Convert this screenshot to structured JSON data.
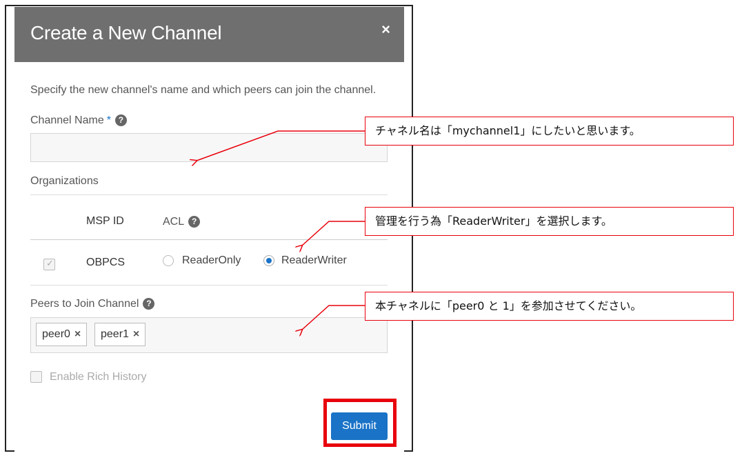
{
  "dialog": {
    "title": "Create a New Channel",
    "close_glyph": "×",
    "intro": "Specify the new channel's name and which peers can join the channel.",
    "channel_name": {
      "label": "Channel Name",
      "required_mark": "*",
      "value": ""
    },
    "help_glyph": "?",
    "organizations": {
      "label": "Organizations",
      "columns": [
        "MSP ID",
        "ACL"
      ],
      "rows": [
        {
          "checked": true,
          "msp_id": "OBPCS",
          "acl_options": [
            "ReaderOnly",
            "ReaderWriter"
          ],
          "acl_selected": "ReaderWriter"
        }
      ]
    },
    "peers": {
      "label": "Peers to Join Channel",
      "chips": [
        "peer0",
        "peer1"
      ],
      "chip_remove_glyph": "×"
    },
    "rich_history": {
      "label": "Enable Rich History",
      "checked": false
    },
    "submit_label": "Submit"
  },
  "annotations": {
    "channel_name_note": "チャネル名は「mychannel1」にしたいと思います。",
    "acl_note": "管理を行う為「ReaderWriter」を選択します。",
    "peers_note": "本チャネルに「peer0 と 1」を参加させてください。"
  },
  "colors": {
    "header": "#6f6f6f",
    "accent": "#1a73c7",
    "highlight": "#e8000b"
  }
}
